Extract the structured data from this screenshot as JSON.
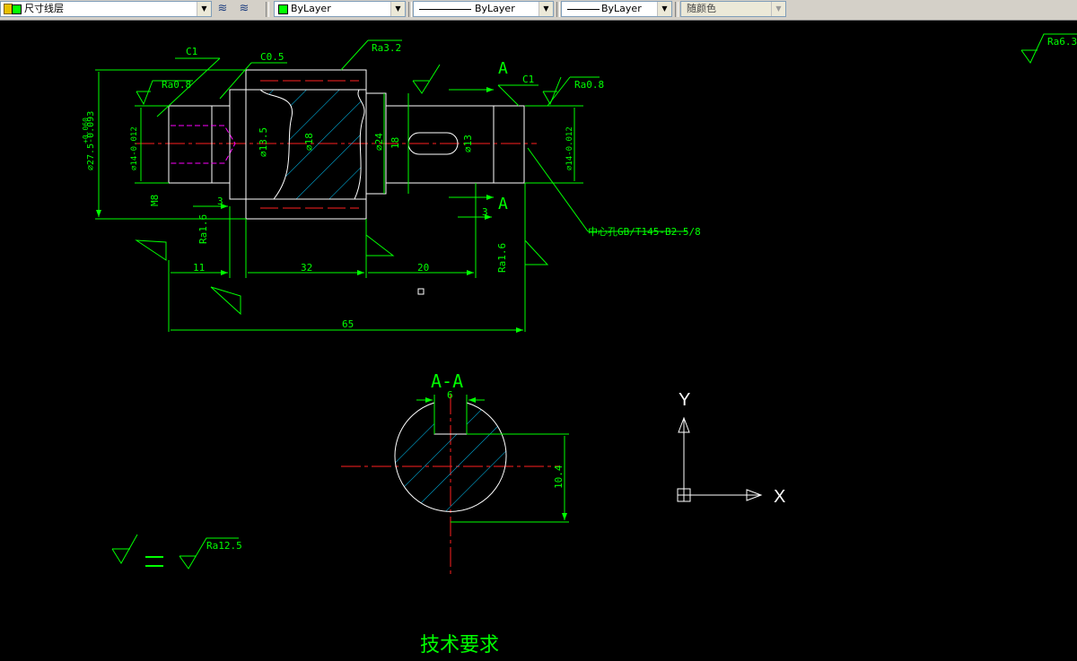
{
  "toolbar": {
    "layer_name": "尺寸线层",
    "color_value": "ByLayer",
    "linetype_value": "ByLayer",
    "lineweight_value": "ByLayer",
    "plotstyle_value": "随颜色"
  },
  "drawing": {
    "labels": {
      "c1_left": "C1",
      "c05": "C0.5",
      "ra32": "Ra3.2",
      "section_a_top": "A",
      "section_a_bottom": "A",
      "c1_right": "C1",
      "ra08_right": "Ra0.8",
      "ra08_left": "Ra0.8",
      "ra63": "Ra6.3",
      "ra16_left": "Ra1.6",
      "ra16_right": "Ra1.6",
      "center_hole": "中心孔GB/T145-B2.5/8",
      "section_title": "A-A",
      "ra125": "Ra12.5",
      "tech_requirements": "技术要求",
      "axis_x": "X",
      "axis_y": "Y"
    },
    "dims": {
      "d_27": "⌀27.5-0.093",
      "d_27_tol": "+0.060",
      "d_14_left": "⌀14-0.012",
      "m8": "M8",
      "d_135": "⌀13.5",
      "d_18": "⌀18",
      "d_24": "⌀24",
      "d_18b": "18",
      "d_13": "⌀13",
      "d_14_right": "⌀14-0.012",
      "d_3_left": "3",
      "d_3_right": "3",
      "d_11": "11",
      "d_32": "32",
      "d_20": "20",
      "d_65": "65",
      "d_6": "6",
      "d_104": "10.4"
    }
  }
}
